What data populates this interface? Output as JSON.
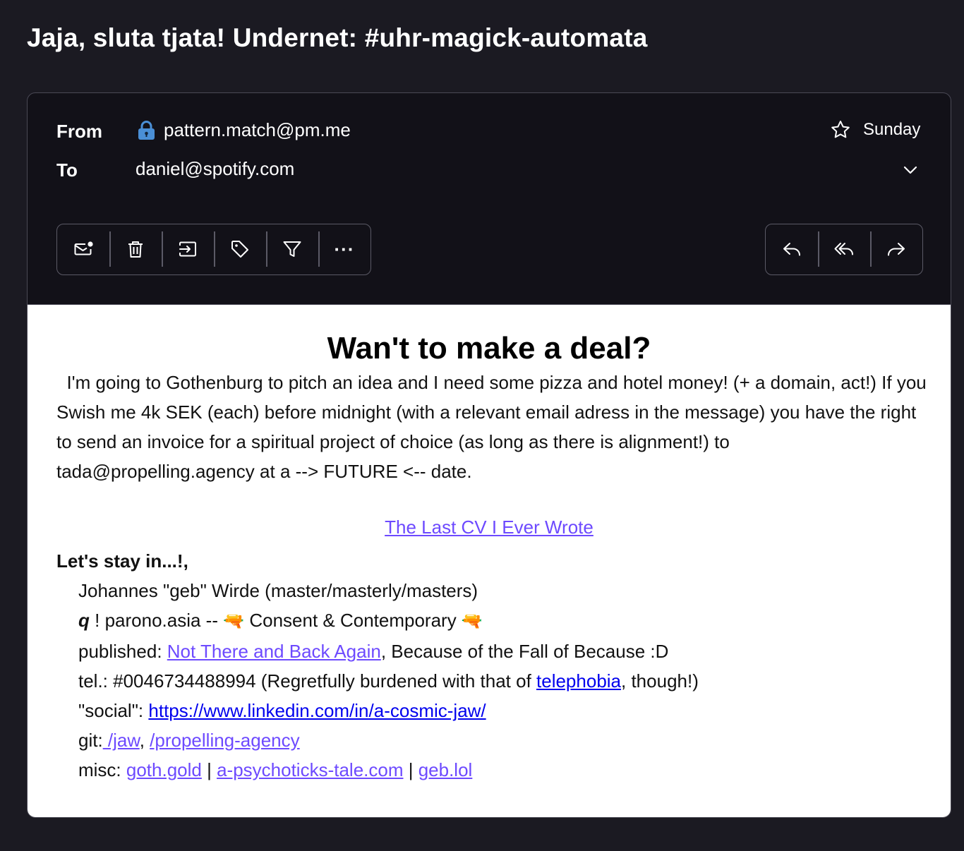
{
  "subject": "Jaja, sluta tjata! Undernet: #uhr-magick-automata",
  "header": {
    "from_label": "From",
    "from_value": "pattern.match@pm.me",
    "to_label": "To",
    "to_value": "daniel@spotify.com",
    "date": "Sunday",
    "icons": [
      "lock-icon",
      "star-icon",
      "chevron-down-icon"
    ]
  },
  "toolbar": {
    "left": [
      "mark-unread-icon",
      "trash-icon",
      "move-icon",
      "label-icon",
      "filter-icon",
      "more-icon"
    ],
    "right": [
      "reply-icon",
      "reply-all-icon",
      "forward-icon"
    ],
    "more_glyph": "···"
  },
  "message": {
    "headline": "Wan't to make a deal?",
    "paragraph": "I'm going to Gothenburg to pitch an idea and I need some pizza and hotel money! (+ a domain, act!) If you Swish me 4k SEK (each) before midnight (with a relevant email adress in the message) you have the right to send an invoice for a spiritual project of choice (as long as there is alignment!) to tada@propelling.agency at a --> FUTURE <-- date.",
    "cv_link": "The Last CV I Ever Wrote",
    "greeting": "Let's stay in...!,",
    "name_line": "Johannes \"geb\" Wirde (master/masterly/masters)",
    "q_mark": "q",
    "parono": "! parono.asia -- ",
    "gun_emoji": "🔫",
    "consent": " Consent & Contemporary ",
    "published_prefix": "published: ",
    "published_link": "Not There and Back Again",
    "published_suffix": ", Because of the Fall of Because :D",
    "tel_prefix": "tel.: #0046734488994 (Regretfully burdened with that of ",
    "tel_link": "telephobia",
    "tel_suffix": ", though!)",
    "social_prefix": "\"social\": ",
    "social_link": "https://www.linkedin.com/in/a-cosmic-jaw/",
    "git_prefix": "git:",
    "git_link1": " /jaw",
    "git_sep": ", ",
    "git_link2": "/propelling-agency",
    "misc_prefix": "misc: ",
    "misc_link1": "goth.gold",
    "misc_sep": " | ",
    "misc_link2": "a-psychoticks-tale.com",
    "misc_link3": "geb.lol"
  },
  "colors": {
    "background": "#1b1a22",
    "panel": "#121118",
    "link": "#6d4aff",
    "link_alt": "#0000ee",
    "lock": "#4a8fd6"
  }
}
